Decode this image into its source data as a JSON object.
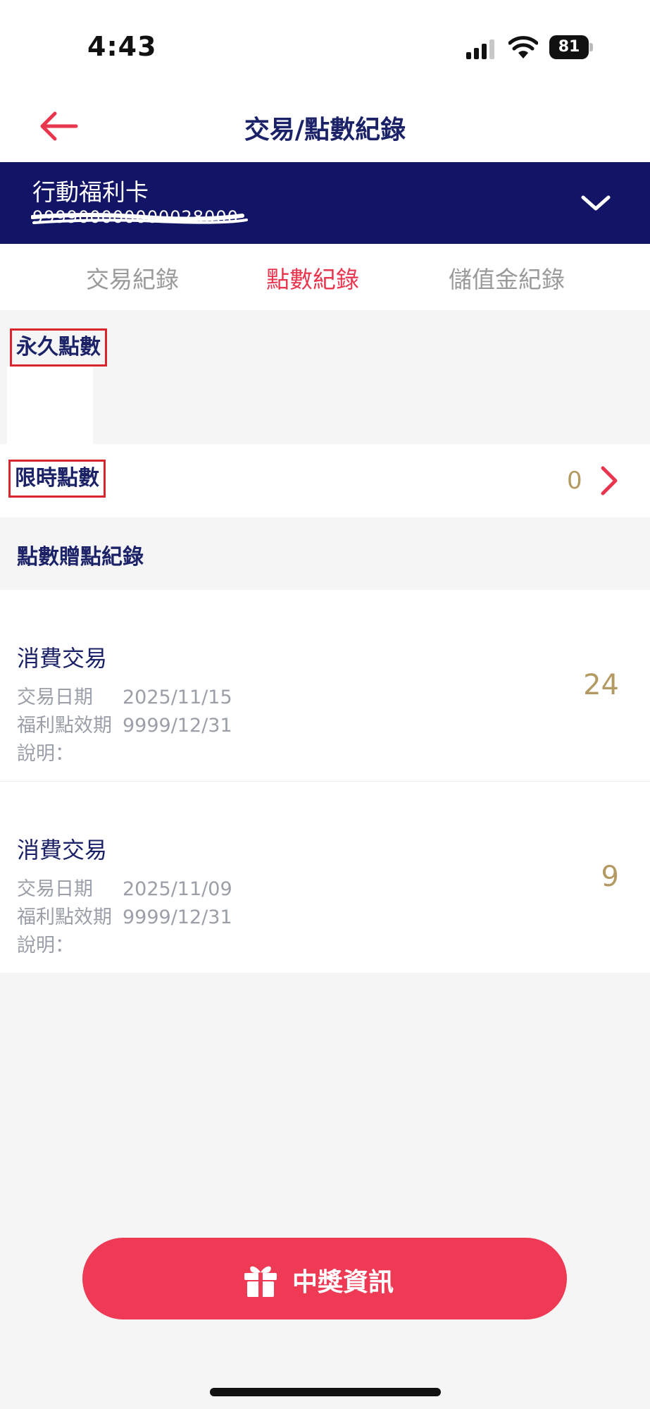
{
  "status_bar": {
    "time": "4:43",
    "battery": "81"
  },
  "header": {
    "title": "交易/點數紀錄"
  },
  "card": {
    "name": "行動福利卡",
    "number": "999900000000028000"
  },
  "tabs": [
    {
      "label": "交易紀錄",
      "active": false
    },
    {
      "label": "點數紀錄",
      "active": true
    },
    {
      "label": "儲值金紀錄",
      "active": false
    }
  ],
  "permanent": {
    "label": "永久點數"
  },
  "limited": {
    "label": "限時點數",
    "value": "0"
  },
  "gift_record": {
    "title": "點數贈點紀錄"
  },
  "records": [
    {
      "title": "消費交易",
      "date_label": "交易日期",
      "date": "2025/11/15",
      "expiry_label": "福利點效期",
      "expiry": "9999/12/31",
      "desc_label": "說明：",
      "points": "24"
    },
    {
      "title": "消費交易",
      "date_label": "交易日期",
      "date": "2025/11/09",
      "expiry_label": "福利點效期",
      "expiry": "9999/12/31",
      "desc_label": "說明：",
      "points": "9"
    }
  ],
  "prize_button": {
    "label": "中獎資訊"
  },
  "colors": {
    "navy": "#1c2268",
    "card_bar": "#121466",
    "accent_red": "#e8364f",
    "gold": "#b29a62",
    "button_red": "#ee3a54"
  }
}
